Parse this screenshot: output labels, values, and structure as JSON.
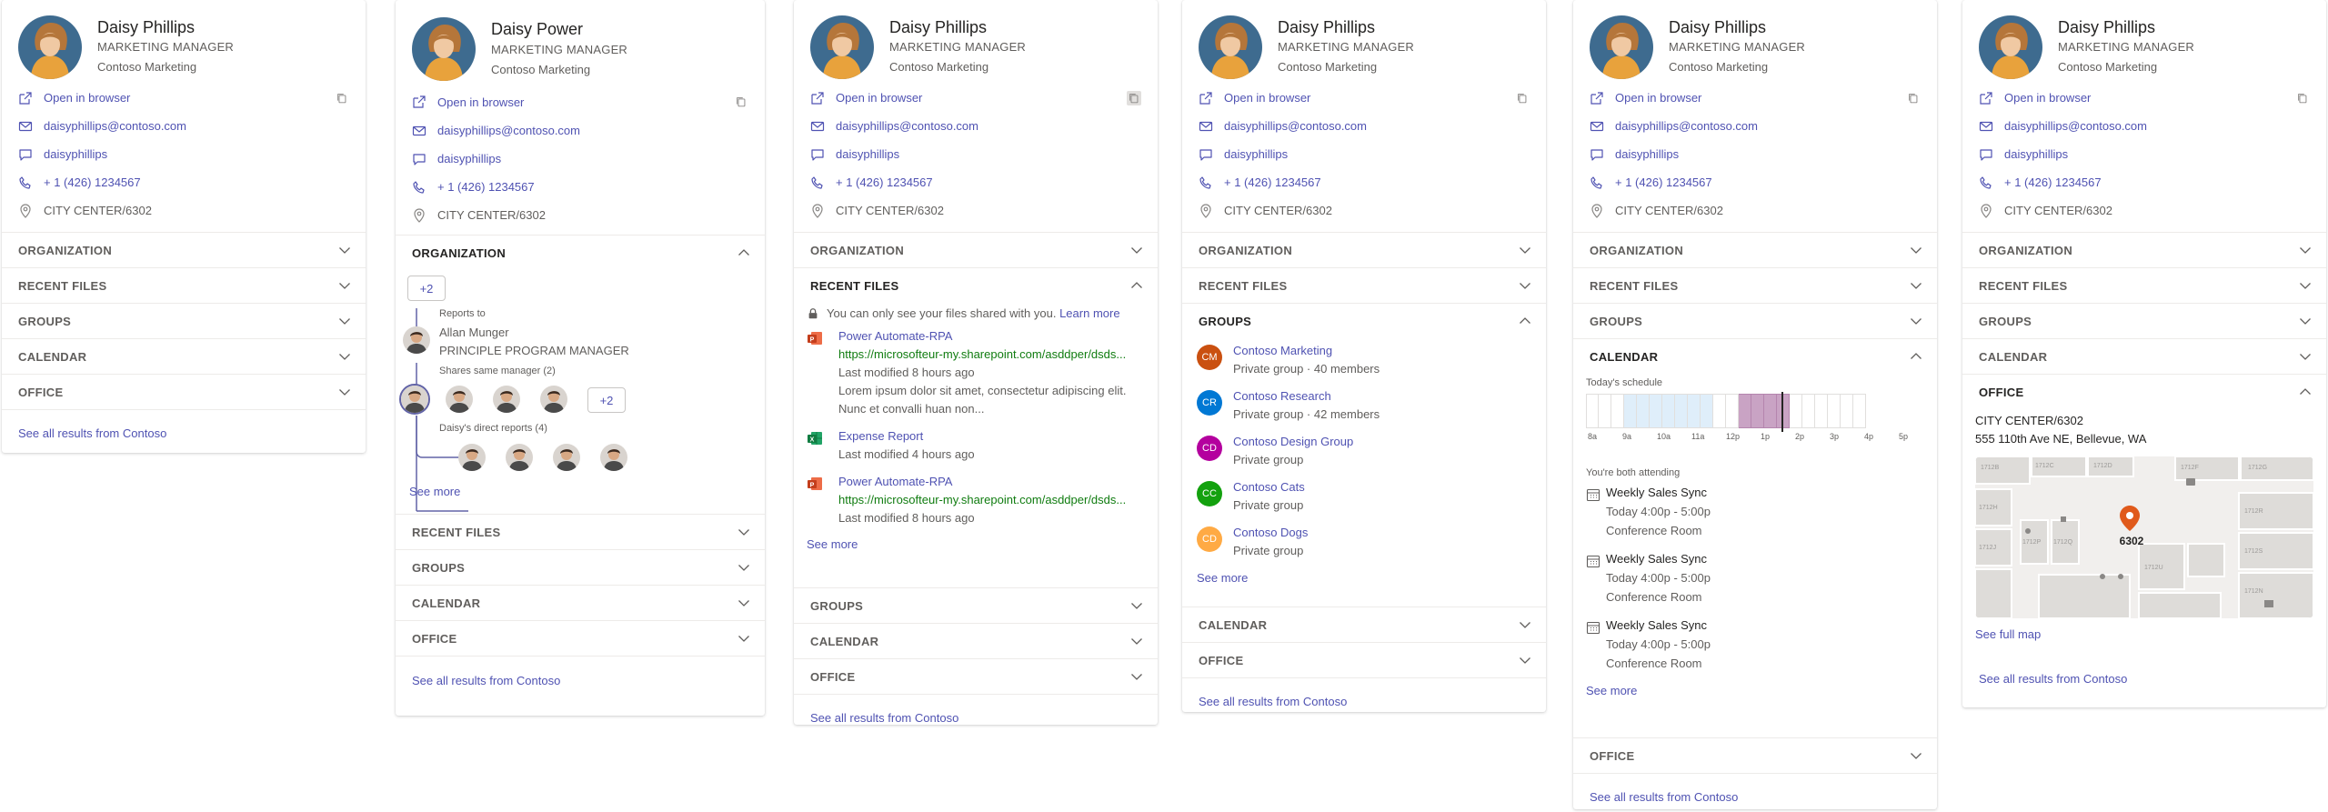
{
  "person": {
    "name": "Daisy Phillips",
    "name_alt": "Daisy Power",
    "title": "MARKETING MANAGER",
    "company": "Contoso Marketing"
  },
  "contact": {
    "open_browser": "Open in browser",
    "email": "daisyphillips@contoso.com",
    "chat": "daisyphillips",
    "phone": "+ 1 (426) 1234567",
    "location": "CITY CENTER/6302"
  },
  "sections": {
    "organization": "ORGANIZATION",
    "recent_files": "RECENT FILES",
    "groups": "GROUPS",
    "calendar": "CALENDAR",
    "office": "OFFICE"
  },
  "see_all": "See all results from Contoso",
  "see_more": "See more",
  "see_full_map": "See full map",
  "org": {
    "more_up": "+2",
    "reports_to_label": "Reports to",
    "manager_name": "Allan Munger",
    "manager_title": "PRINCIPLE PROGRAM MANAGER",
    "peers_label": "Shares same manager (2)",
    "peers_more": "+2",
    "direct_label": "Daisy's direct reports (4)"
  },
  "files": {
    "notice": "You can only see your files shared with you.",
    "learn_more": "Learn more",
    "items": [
      {
        "name": "Power Automate-RPA",
        "url": "https://microsofteur-my.sharepoint.com/asddper/dsds...",
        "modified": "Last modified 8 hours ago",
        "desc1": "Lorem ipsum dolor sit amet, consectetur adipiscing elit.",
        "desc2": "Nunc et convalli huan non..."
      },
      {
        "name": "Expense Report",
        "modified": "Last modified 4 hours ago"
      },
      {
        "name": "Power Automate-RPA",
        "url": "https://microsofteur-my.sharepoint.com/asddper/dsds...",
        "modified": "Last modified 8 hours ago"
      }
    ]
  },
  "groups": [
    {
      "initials": "CM",
      "name": "Contoso Marketing",
      "desc": "Private group · 40 members",
      "color": "#ca5010"
    },
    {
      "initials": "CR",
      "name": "Contoso Research",
      "desc": "Private group · 42 members",
      "color": "#0078d4"
    },
    {
      "initials": "CD",
      "name": "Contoso Design Group",
      "desc": "Private group",
      "color": "#b4009e"
    },
    {
      "initials": "CC",
      "name": "Contoso Cats",
      "desc": "Private group",
      "color": "#13a10e"
    },
    {
      "initials": "CD",
      "name": "Contoso Dogs",
      "desc": "Private group",
      "color": "#ffaa44"
    }
  ],
  "calendar": {
    "today_label": "Today's schedule",
    "hours": [
      "8a",
      "9a",
      "10a",
      "11a",
      "12p",
      "1p",
      "2p",
      "3p",
      "4p",
      "5p"
    ],
    "attending_label": "You're both attending",
    "events": [
      {
        "name": "Weekly Sales Sync",
        "time": "Today 4:00p - 5:00p",
        "room": "Conference Room"
      },
      {
        "name": "Weekly Sales Sync",
        "time": "Today 4:00p - 5:00p",
        "room": "Conference Room"
      },
      {
        "name": "Weekly Sales Sync",
        "time": "Today 4:00p - 5:00p",
        "room": "Conference Room"
      }
    ]
  },
  "office": {
    "location": "CITY CENTER/6302",
    "address": "555 110th Ave NE, Bellevue, WA",
    "pin_label": "6302",
    "map_labels": [
      "1712B",
      "1712C",
      "1712D",
      "1712F",
      "1712G",
      "1712H",
      "1712J",
      "1712P",
      "1712Q",
      "1712R",
      "1712S",
      "1712U",
      "1712N"
    ]
  },
  "colors": {
    "link": "#4f52b2",
    "url_green": "#107c10",
    "pin": "#e05a1b",
    "schedule_busy": "#c9a3c4",
    "schedule_free": "#dfeefa"
  }
}
